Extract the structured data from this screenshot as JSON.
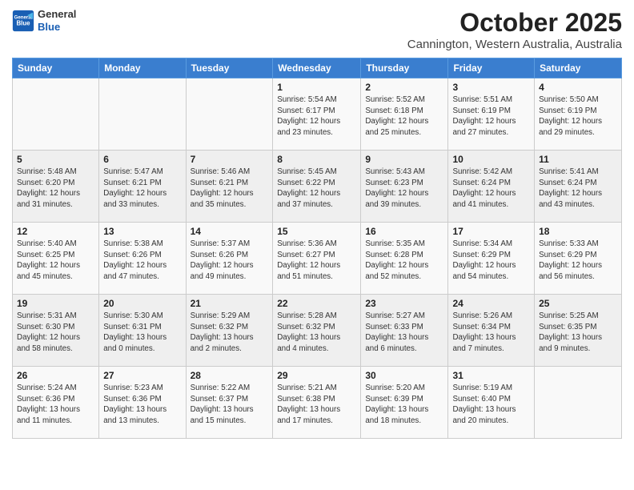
{
  "header": {
    "logo_line1": "General",
    "logo_line2": "Blue",
    "title": "October 2025",
    "subtitle": "Cannington, Western Australia, Australia"
  },
  "weekdays": [
    "Sunday",
    "Monday",
    "Tuesday",
    "Wednesday",
    "Thursday",
    "Friday",
    "Saturday"
  ],
  "weeks": [
    [
      {
        "day": "",
        "info": ""
      },
      {
        "day": "",
        "info": ""
      },
      {
        "day": "",
        "info": ""
      },
      {
        "day": "1",
        "info": "Sunrise: 5:54 AM\nSunset: 6:17 PM\nDaylight: 12 hours\nand 23 minutes."
      },
      {
        "day": "2",
        "info": "Sunrise: 5:52 AM\nSunset: 6:18 PM\nDaylight: 12 hours\nand 25 minutes."
      },
      {
        "day": "3",
        "info": "Sunrise: 5:51 AM\nSunset: 6:19 PM\nDaylight: 12 hours\nand 27 minutes."
      },
      {
        "day": "4",
        "info": "Sunrise: 5:50 AM\nSunset: 6:19 PM\nDaylight: 12 hours\nand 29 minutes."
      }
    ],
    [
      {
        "day": "5",
        "info": "Sunrise: 5:48 AM\nSunset: 6:20 PM\nDaylight: 12 hours\nand 31 minutes."
      },
      {
        "day": "6",
        "info": "Sunrise: 5:47 AM\nSunset: 6:21 PM\nDaylight: 12 hours\nand 33 minutes."
      },
      {
        "day": "7",
        "info": "Sunrise: 5:46 AM\nSunset: 6:21 PM\nDaylight: 12 hours\nand 35 minutes."
      },
      {
        "day": "8",
        "info": "Sunrise: 5:45 AM\nSunset: 6:22 PM\nDaylight: 12 hours\nand 37 minutes."
      },
      {
        "day": "9",
        "info": "Sunrise: 5:43 AM\nSunset: 6:23 PM\nDaylight: 12 hours\nand 39 minutes."
      },
      {
        "day": "10",
        "info": "Sunrise: 5:42 AM\nSunset: 6:24 PM\nDaylight: 12 hours\nand 41 minutes."
      },
      {
        "day": "11",
        "info": "Sunrise: 5:41 AM\nSunset: 6:24 PM\nDaylight: 12 hours\nand 43 minutes."
      }
    ],
    [
      {
        "day": "12",
        "info": "Sunrise: 5:40 AM\nSunset: 6:25 PM\nDaylight: 12 hours\nand 45 minutes."
      },
      {
        "day": "13",
        "info": "Sunrise: 5:38 AM\nSunset: 6:26 PM\nDaylight: 12 hours\nand 47 minutes."
      },
      {
        "day": "14",
        "info": "Sunrise: 5:37 AM\nSunset: 6:26 PM\nDaylight: 12 hours\nand 49 minutes."
      },
      {
        "day": "15",
        "info": "Sunrise: 5:36 AM\nSunset: 6:27 PM\nDaylight: 12 hours\nand 51 minutes."
      },
      {
        "day": "16",
        "info": "Sunrise: 5:35 AM\nSunset: 6:28 PM\nDaylight: 12 hours\nand 52 minutes."
      },
      {
        "day": "17",
        "info": "Sunrise: 5:34 AM\nSunset: 6:29 PM\nDaylight: 12 hours\nand 54 minutes."
      },
      {
        "day": "18",
        "info": "Sunrise: 5:33 AM\nSunset: 6:29 PM\nDaylight: 12 hours\nand 56 minutes."
      }
    ],
    [
      {
        "day": "19",
        "info": "Sunrise: 5:31 AM\nSunset: 6:30 PM\nDaylight: 12 hours\nand 58 minutes."
      },
      {
        "day": "20",
        "info": "Sunrise: 5:30 AM\nSunset: 6:31 PM\nDaylight: 13 hours\nand 0 minutes."
      },
      {
        "day": "21",
        "info": "Sunrise: 5:29 AM\nSunset: 6:32 PM\nDaylight: 13 hours\nand 2 minutes."
      },
      {
        "day": "22",
        "info": "Sunrise: 5:28 AM\nSunset: 6:32 PM\nDaylight: 13 hours\nand 4 minutes."
      },
      {
        "day": "23",
        "info": "Sunrise: 5:27 AM\nSunset: 6:33 PM\nDaylight: 13 hours\nand 6 minutes."
      },
      {
        "day": "24",
        "info": "Sunrise: 5:26 AM\nSunset: 6:34 PM\nDaylight: 13 hours\nand 7 minutes."
      },
      {
        "day": "25",
        "info": "Sunrise: 5:25 AM\nSunset: 6:35 PM\nDaylight: 13 hours\nand 9 minutes."
      }
    ],
    [
      {
        "day": "26",
        "info": "Sunrise: 5:24 AM\nSunset: 6:36 PM\nDaylight: 13 hours\nand 11 minutes."
      },
      {
        "day": "27",
        "info": "Sunrise: 5:23 AM\nSunset: 6:36 PM\nDaylight: 13 hours\nand 13 minutes."
      },
      {
        "day": "28",
        "info": "Sunrise: 5:22 AM\nSunset: 6:37 PM\nDaylight: 13 hours\nand 15 minutes."
      },
      {
        "day": "29",
        "info": "Sunrise: 5:21 AM\nSunset: 6:38 PM\nDaylight: 13 hours\nand 17 minutes."
      },
      {
        "day": "30",
        "info": "Sunrise: 5:20 AM\nSunset: 6:39 PM\nDaylight: 13 hours\nand 18 minutes."
      },
      {
        "day": "31",
        "info": "Sunrise: 5:19 AM\nSunset: 6:40 PM\nDaylight: 13 hours\nand 20 minutes."
      },
      {
        "day": "",
        "info": ""
      }
    ]
  ]
}
